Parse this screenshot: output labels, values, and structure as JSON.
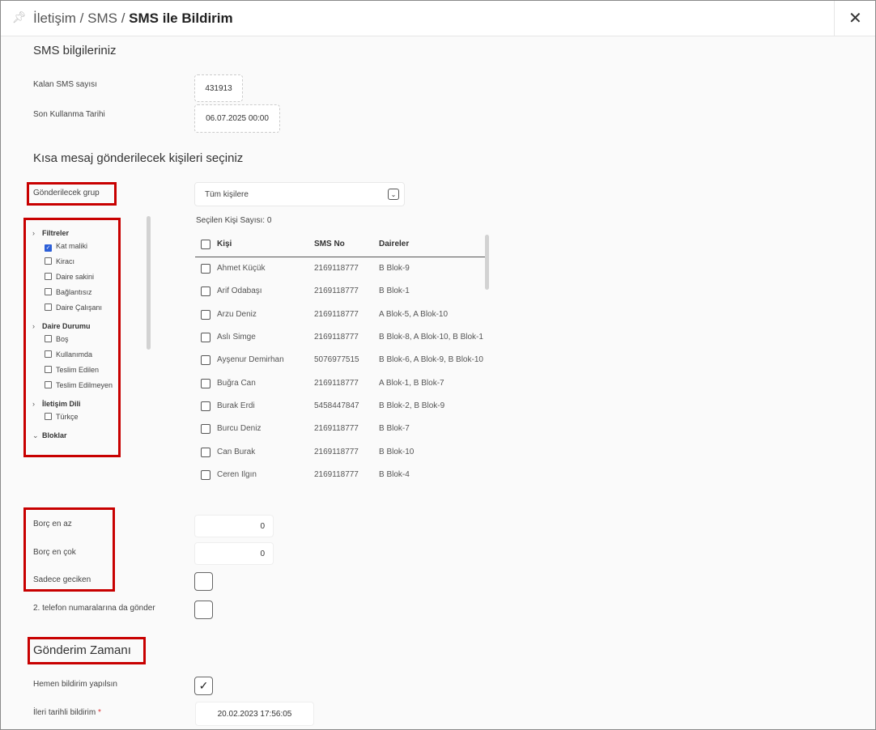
{
  "header": {
    "crumb1": "İletişim",
    "sep1": "/",
    "crumb2": "SMS",
    "sep2": "/",
    "current": "SMS ile Bildirim",
    "pin_icon": "pin-icon",
    "close_icon": "close-icon"
  },
  "sms_info": {
    "title": "SMS bilgileriniz",
    "remaining_label": "Kalan SMS sayısı",
    "remaining_value": "431913",
    "last_use_label": "Son Kullanma Tarihi",
    "last_use_value": "06.07.2025 00:00"
  },
  "select_section": {
    "title": "Kısa mesaj gönderilecek kişileri seçiniz",
    "group_label": "Gönderilecek grup",
    "group_value": "Tüm kişilere",
    "selected_count": "Seçilen Kişi Sayısı: 0"
  },
  "filters": {
    "groups": [
      {
        "title": "Filtreler",
        "items": [
          {
            "label": "Kat maliki",
            "checked": true
          },
          {
            "label": "Kiracı",
            "checked": false
          },
          {
            "label": "Daire sakini",
            "checked": false
          },
          {
            "label": "Bağlantısız",
            "checked": false
          },
          {
            "label": "Daire Çalışanı",
            "checked": false
          }
        ]
      },
      {
        "title": "Daire Durumu",
        "items": [
          {
            "label": "Boş",
            "checked": false
          },
          {
            "label": "Kullanımda",
            "checked": false
          },
          {
            "label": "Teslim Edilen",
            "checked": false
          },
          {
            "label": "Teslim Edilmeyen",
            "checked": false
          }
        ]
      },
      {
        "title": "İletişim Dili",
        "items": [
          {
            "label": "Türkçe",
            "checked": false
          }
        ]
      },
      {
        "title": "Bloklar",
        "items": []
      }
    ]
  },
  "table": {
    "headers": [
      "Kişi",
      "SMS No",
      "Daireler"
    ],
    "rows": [
      [
        "Ahmet Küçük",
        "2169118777",
        "B Blok-9"
      ],
      [
        "Arif Odabaşı",
        "2169118777",
        "B Blok-1"
      ],
      [
        "Arzu Deniz",
        "2169118777",
        "A Blok-5, A Blok-10"
      ],
      [
        "Aslı Simge",
        "2169118777",
        "B Blok-8, A Blok-10, B Blok-1"
      ],
      [
        "Ayşenur Demirhan",
        "5076977515",
        "B Blok-6, A Blok-9, B Blok-10"
      ],
      [
        "Buğra Can",
        "2169118777",
        "A Blok-1, B Blok-7"
      ],
      [
        "Burak Erdi",
        "5458447847",
        "B Blok-2, B Blok-9"
      ],
      [
        "Burcu Deniz",
        "2169118777",
        "B Blok-7"
      ],
      [
        "Can Burak",
        "2169118777",
        "B Blok-10"
      ],
      [
        "Ceren Ilgın",
        "2169118777",
        "B Blok-4"
      ]
    ]
  },
  "debt": {
    "min_label": "Borç en az",
    "min_value": "0",
    "max_label": "Borç en çok",
    "max_value": "0",
    "late_label": "Sadece geciken",
    "second_phone_label": "2. telefon numaralarına da gönder"
  },
  "schedule": {
    "title": "Gönderim Zamanı",
    "now_label": "Hemen bildirim yapılsın",
    "now_checked": true,
    "future_label": "İleri tarihli bildirim",
    "required_mark": "*",
    "future_value": "20.02.2023 17:56:05"
  },
  "colors": {
    "highlight": "#c80000",
    "checkbox_on": "#2c5fd8"
  }
}
